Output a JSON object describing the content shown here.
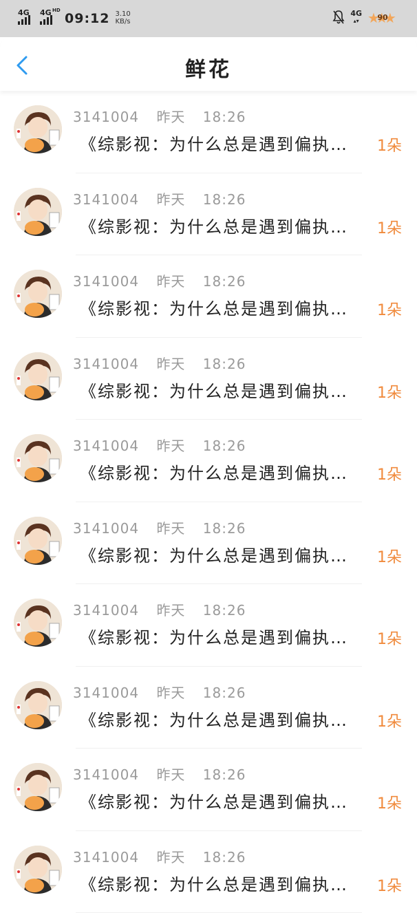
{
  "status_bar": {
    "signal1_label": "4G",
    "signal2_label": "4G",
    "signal2_sup": "HD",
    "time": "09:12",
    "speed_value": "3.10",
    "speed_unit": "KB/s",
    "network_label": "4G",
    "network_sub": "▴▾",
    "battery": "90",
    "battery_color": "#f2a65a"
  },
  "header": {
    "back_icon": "chevron-left-icon",
    "title": "鲜花",
    "accent_color": "#2f9bf0"
  },
  "items": [
    {
      "user": "3141004",
      "day": "昨天",
      "time": "18:26",
      "message": "《综影视：为什么总是遇到偏执…",
      "count": "1朵"
    },
    {
      "user": "3141004",
      "day": "昨天",
      "time": "18:26",
      "message": "《综影视：为什么总是遇到偏执…",
      "count": "1朵"
    },
    {
      "user": "3141004",
      "day": "昨天",
      "time": "18:26",
      "message": "《综影视：为什么总是遇到偏执…",
      "count": "1朵"
    },
    {
      "user": "3141004",
      "day": "昨天",
      "time": "18:26",
      "message": "《综影视：为什么总是遇到偏执…",
      "count": "1朵"
    },
    {
      "user": "3141004",
      "day": "昨天",
      "time": "18:26",
      "message": "《综影视：为什么总是遇到偏执…",
      "count": "1朵"
    },
    {
      "user": "3141004",
      "day": "昨天",
      "time": "18:26",
      "message": "《综影视：为什么总是遇到偏执…",
      "count": "1朵"
    },
    {
      "user": "3141004",
      "day": "昨天",
      "time": "18:26",
      "message": "《综影视：为什么总是遇到偏执…",
      "count": "1朵"
    },
    {
      "user": "3141004",
      "day": "昨天",
      "time": "18:26",
      "message": "《综影视：为什么总是遇到偏执…",
      "count": "1朵"
    },
    {
      "user": "3141004",
      "day": "昨天",
      "time": "18:26",
      "message": "《综影视：为什么总是遇到偏执…",
      "count": "1朵"
    },
    {
      "user": "3141004",
      "day": "昨天",
      "time": "18:26",
      "message": "《综影视：为什么总是遇到偏执…",
      "count": "1朵"
    }
  ],
  "count_color": "#f08a3c"
}
